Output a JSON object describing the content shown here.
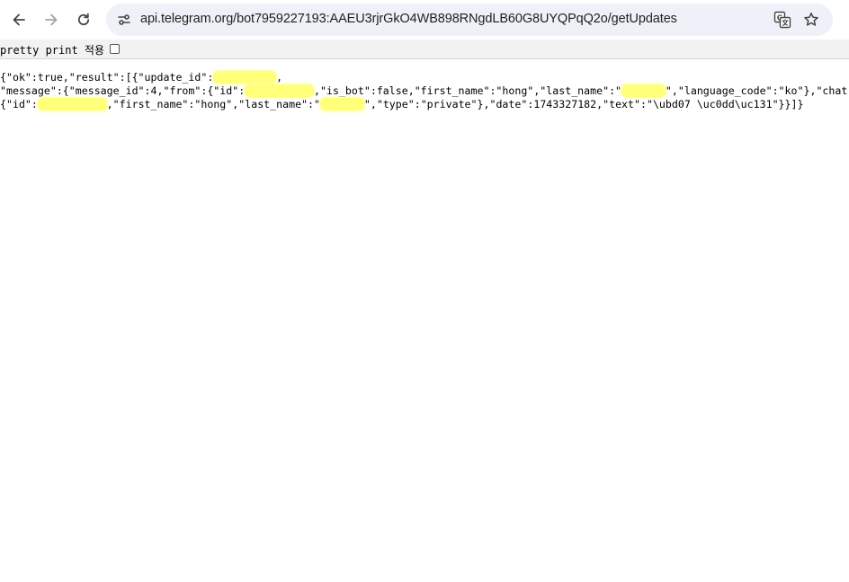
{
  "browser": {
    "url": "api.telegram.org/bot7959227193:AAEU3rjrGkO4WB898RNgdLB60G8UYQPqQ2o/getUpdates",
    "nav_icons": [
      "back-arrow-icon",
      "forward-arrow-icon",
      "reload-icon",
      "site-info-icon",
      "translate-icon",
      "star-icon"
    ]
  },
  "pretty_print": {
    "label": "pretty print 적용",
    "checked": false
  },
  "json_lines": [
    [
      {
        "t": "{\"ok\":true,\"result\":[{\"update_id\":"
      },
      {
        "r": "          "
      },
      {
        "t": ","
      }
    ],
    [
      {
        "t": "\"message\":{\"message_id\":4,\"from\":{\"id\":"
      },
      {
        "r": "           "
      },
      {
        "t": ",\"is_bot\":false,\"first_name\":\"hong\",\"last_name\":\""
      },
      {
        "r": "       "
      },
      {
        "t": "\",\"language_code\":\"ko\"},\"chat\":"
      }
    ],
    [
      {
        "t": "{\"id\":"
      },
      {
        "r": "           "
      },
      {
        "t": ",\"first_name\":\"hong\",\"last_name\":\""
      },
      {
        "r": "       "
      },
      {
        "t": "\",\"type\":\"private\"},\"date\":1743327182,\"text\":\"\\ubd07 \\uc0dd\\uc131\"}}]}"
      }
    ]
  ],
  "colors": {
    "redaction_highlight": "#ffff7a",
    "omnibox_bg": "#eef2f8",
    "pretty_print_bar_bg": "#f2f2f2"
  }
}
